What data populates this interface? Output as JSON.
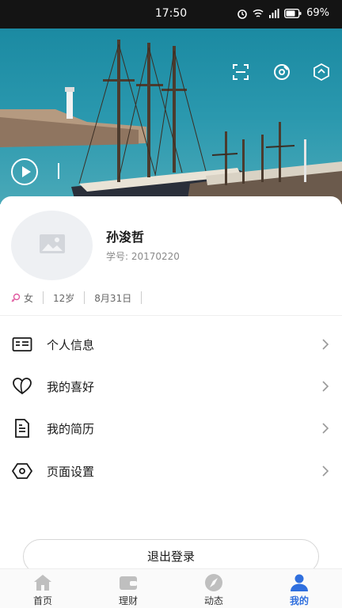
{
  "status_bar": {
    "time": "17:50",
    "battery": "69%"
  },
  "profile": {
    "name": "孙浚哲",
    "student_id": "学号: 20170220",
    "gender": "女",
    "age": "12岁",
    "birthday": "8月31日"
  },
  "menu": [
    {
      "label": "个人信息",
      "icon": "id-card-icon"
    },
    {
      "label": "我的喜好",
      "icon": "heart-icon"
    },
    {
      "label": "我的简历",
      "icon": "resume-icon"
    },
    {
      "label": "页面设置",
      "icon": "settings-hexagon-icon"
    }
  ],
  "logout_label": "退出登录",
  "tabs": [
    {
      "label": "首页",
      "icon": "home-icon",
      "active": false
    },
    {
      "label": "理财",
      "icon": "wallet-icon",
      "active": false
    },
    {
      "label": "动态",
      "icon": "compass-icon",
      "active": false
    },
    {
      "label": "我的",
      "icon": "person-icon",
      "active": true
    }
  ],
  "colors": {
    "accent": "#2f6fde",
    "tab_inactive": "#bfbfbf",
    "status_bar": "#141414"
  }
}
